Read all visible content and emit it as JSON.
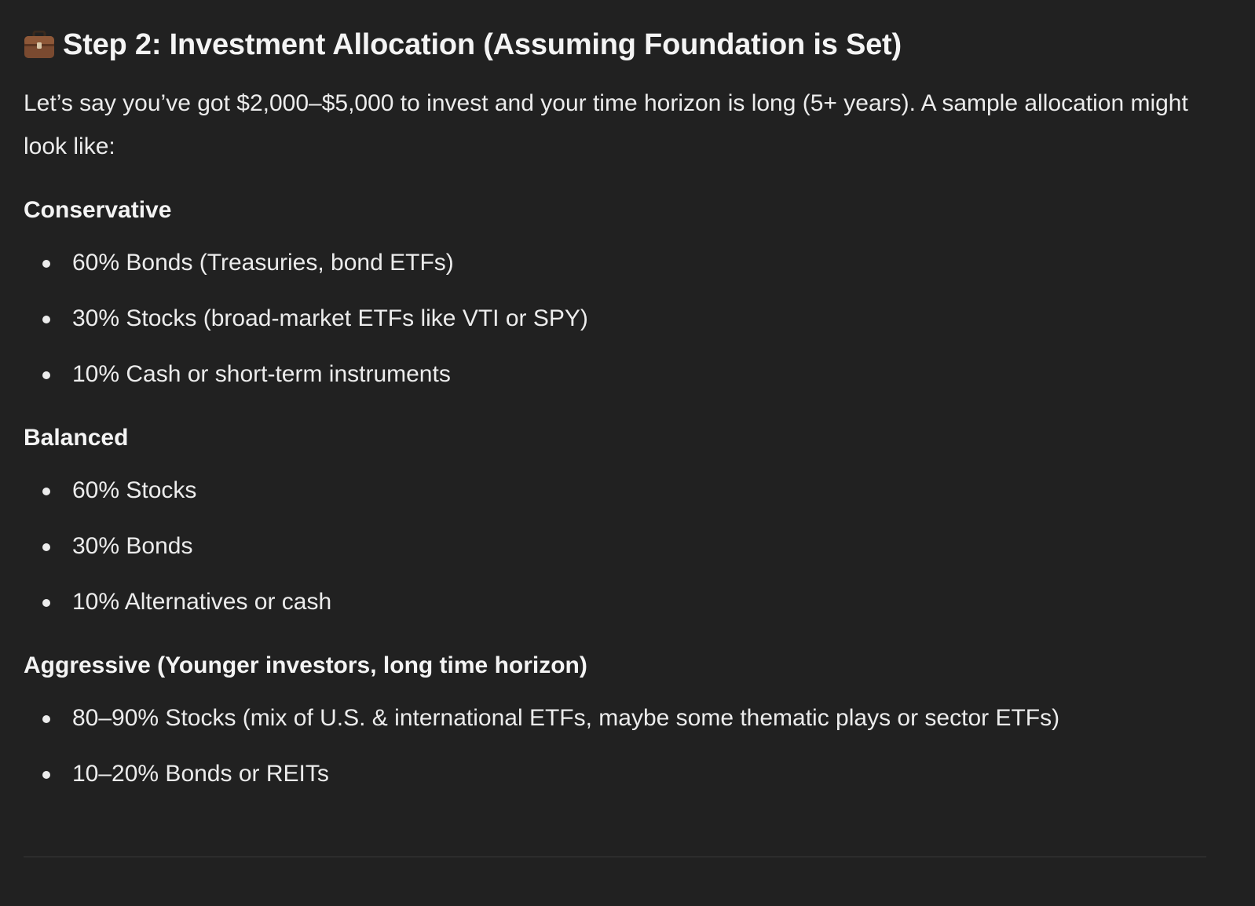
{
  "heading": {
    "icon": "briefcase-icon",
    "text": "Step 2: Investment Allocation (Assuming Foundation is Set)"
  },
  "intro": "Let’s say you’ve got $2,000–$5,000 to invest and your time horizon is long (5+ years). A sample allocation might look like:",
  "sections": [
    {
      "title": "Conservative",
      "items": [
        "60% Bonds (Treasuries, bond ETFs)",
        "30% Stocks (broad-market ETFs like VTI or SPY)",
        "10% Cash or short-term instruments"
      ]
    },
    {
      "title": "Balanced",
      "items": [
        "60% Stocks",
        "30% Bonds",
        "10% Alternatives or cash"
      ]
    },
    {
      "title": "Aggressive (Younger investors, long time horizon)",
      "items": [
        "80–90% Stocks (mix of U.S. & international ETFs, maybe some thematic plays or sector ETFs)",
        "10–20% Bonds or REITs"
      ]
    }
  ],
  "colors": {
    "background": "#212121",
    "text": "#ececec",
    "heading": "#f4f4f4"
  }
}
